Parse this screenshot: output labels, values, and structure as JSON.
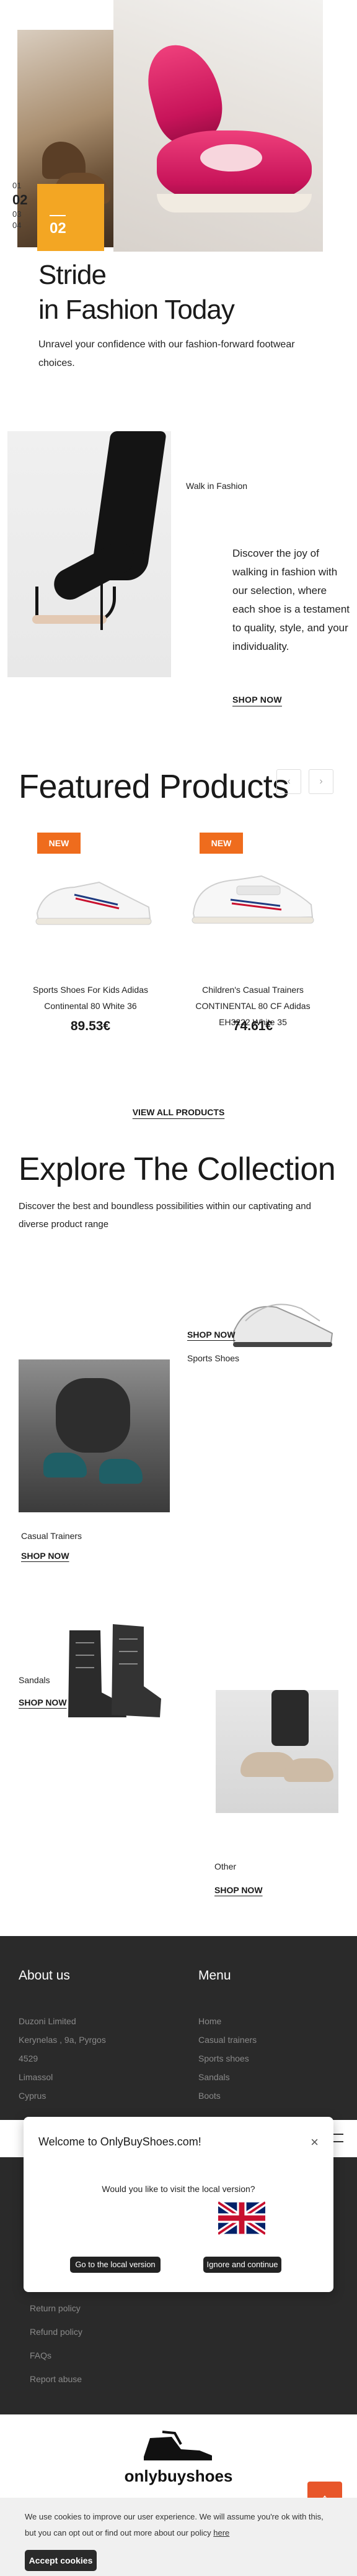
{
  "hero": {
    "slides": [
      "01",
      "02",
      "03",
      "04"
    ],
    "active_slide": "02",
    "badge_number": "02",
    "title_line1": "Stride",
    "title_line2": "in Fashion Today",
    "subtitle": "Unravel your confidence with our fashion-forward footwear choices."
  },
  "walk": {
    "label": "Walk in Fashion",
    "text": "Discover the joy of walking in fashion with our selection, where each shoe is a testament to quality, style, and your individuality.",
    "link": "SHOP NOW"
  },
  "featured": {
    "title": "Featured Products",
    "prev_icon": "‹",
    "next_icon": "›",
    "products": [
      {
        "badge": "NEW",
        "name": "Sports Shoes For Kids Adidas Continental 80 White 36",
        "price": "89.53€"
      },
      {
        "badge": "NEW",
        "name": "Children's Casual Trainers CONTINENTAL 80 CF Adidas EH3222 White 35",
        "price": "74.61€"
      }
    ],
    "view_all": "VIEW ALL PRODUCTS"
  },
  "collection": {
    "title": "Explore The Collection",
    "subtitle": "Discover the best and boundless possibilities within our captivating and diverse product range",
    "items": [
      {
        "label": "Sports Shoes",
        "link": "SHOP NOW"
      },
      {
        "label": "Casual Trainers",
        "link": "SHOP NOW"
      },
      {
        "label": "Sandals",
        "link": "SHOP NOW"
      },
      {
        "label": "Other",
        "link": "SHOP NOW"
      }
    ]
  },
  "footer": {
    "about_title": "About us",
    "about_lines": [
      "Duzoni Limited",
      "Kerynelas , 9a, Pyrgos",
      "4529",
      "Limassol",
      "Cyprus"
    ],
    "menu_title": "Menu",
    "menu_items": [
      "Home",
      "Casual trainers",
      "Sports shoes",
      "Sandals",
      "Boots"
    ],
    "support_items": [
      "Return policy",
      "Refund policy",
      "FAQs",
      "Report abuse"
    ],
    "logo_text": "onlybuyshoes"
  },
  "modal": {
    "title": "Welcome to OnlyBuyShoes.com!",
    "question": "Would you like to visit the local version?",
    "go_button": "Go to the local version",
    "ignore_button": "Ignore and continue",
    "close_icon": "×"
  },
  "cookie": {
    "text_before": "We use cookies to improve our user experience. We will assume you're ok with this, but you can opt out or find out more about our policy ",
    "link": "here",
    "button": "Accept cookies"
  },
  "scroll_top_icon": "↑",
  "colors": {
    "accent_orange": "#f3a623",
    "badge_orange": "#ef6c1d",
    "footer_bg": "#2a2a2a",
    "to_top": "#e8562a"
  }
}
